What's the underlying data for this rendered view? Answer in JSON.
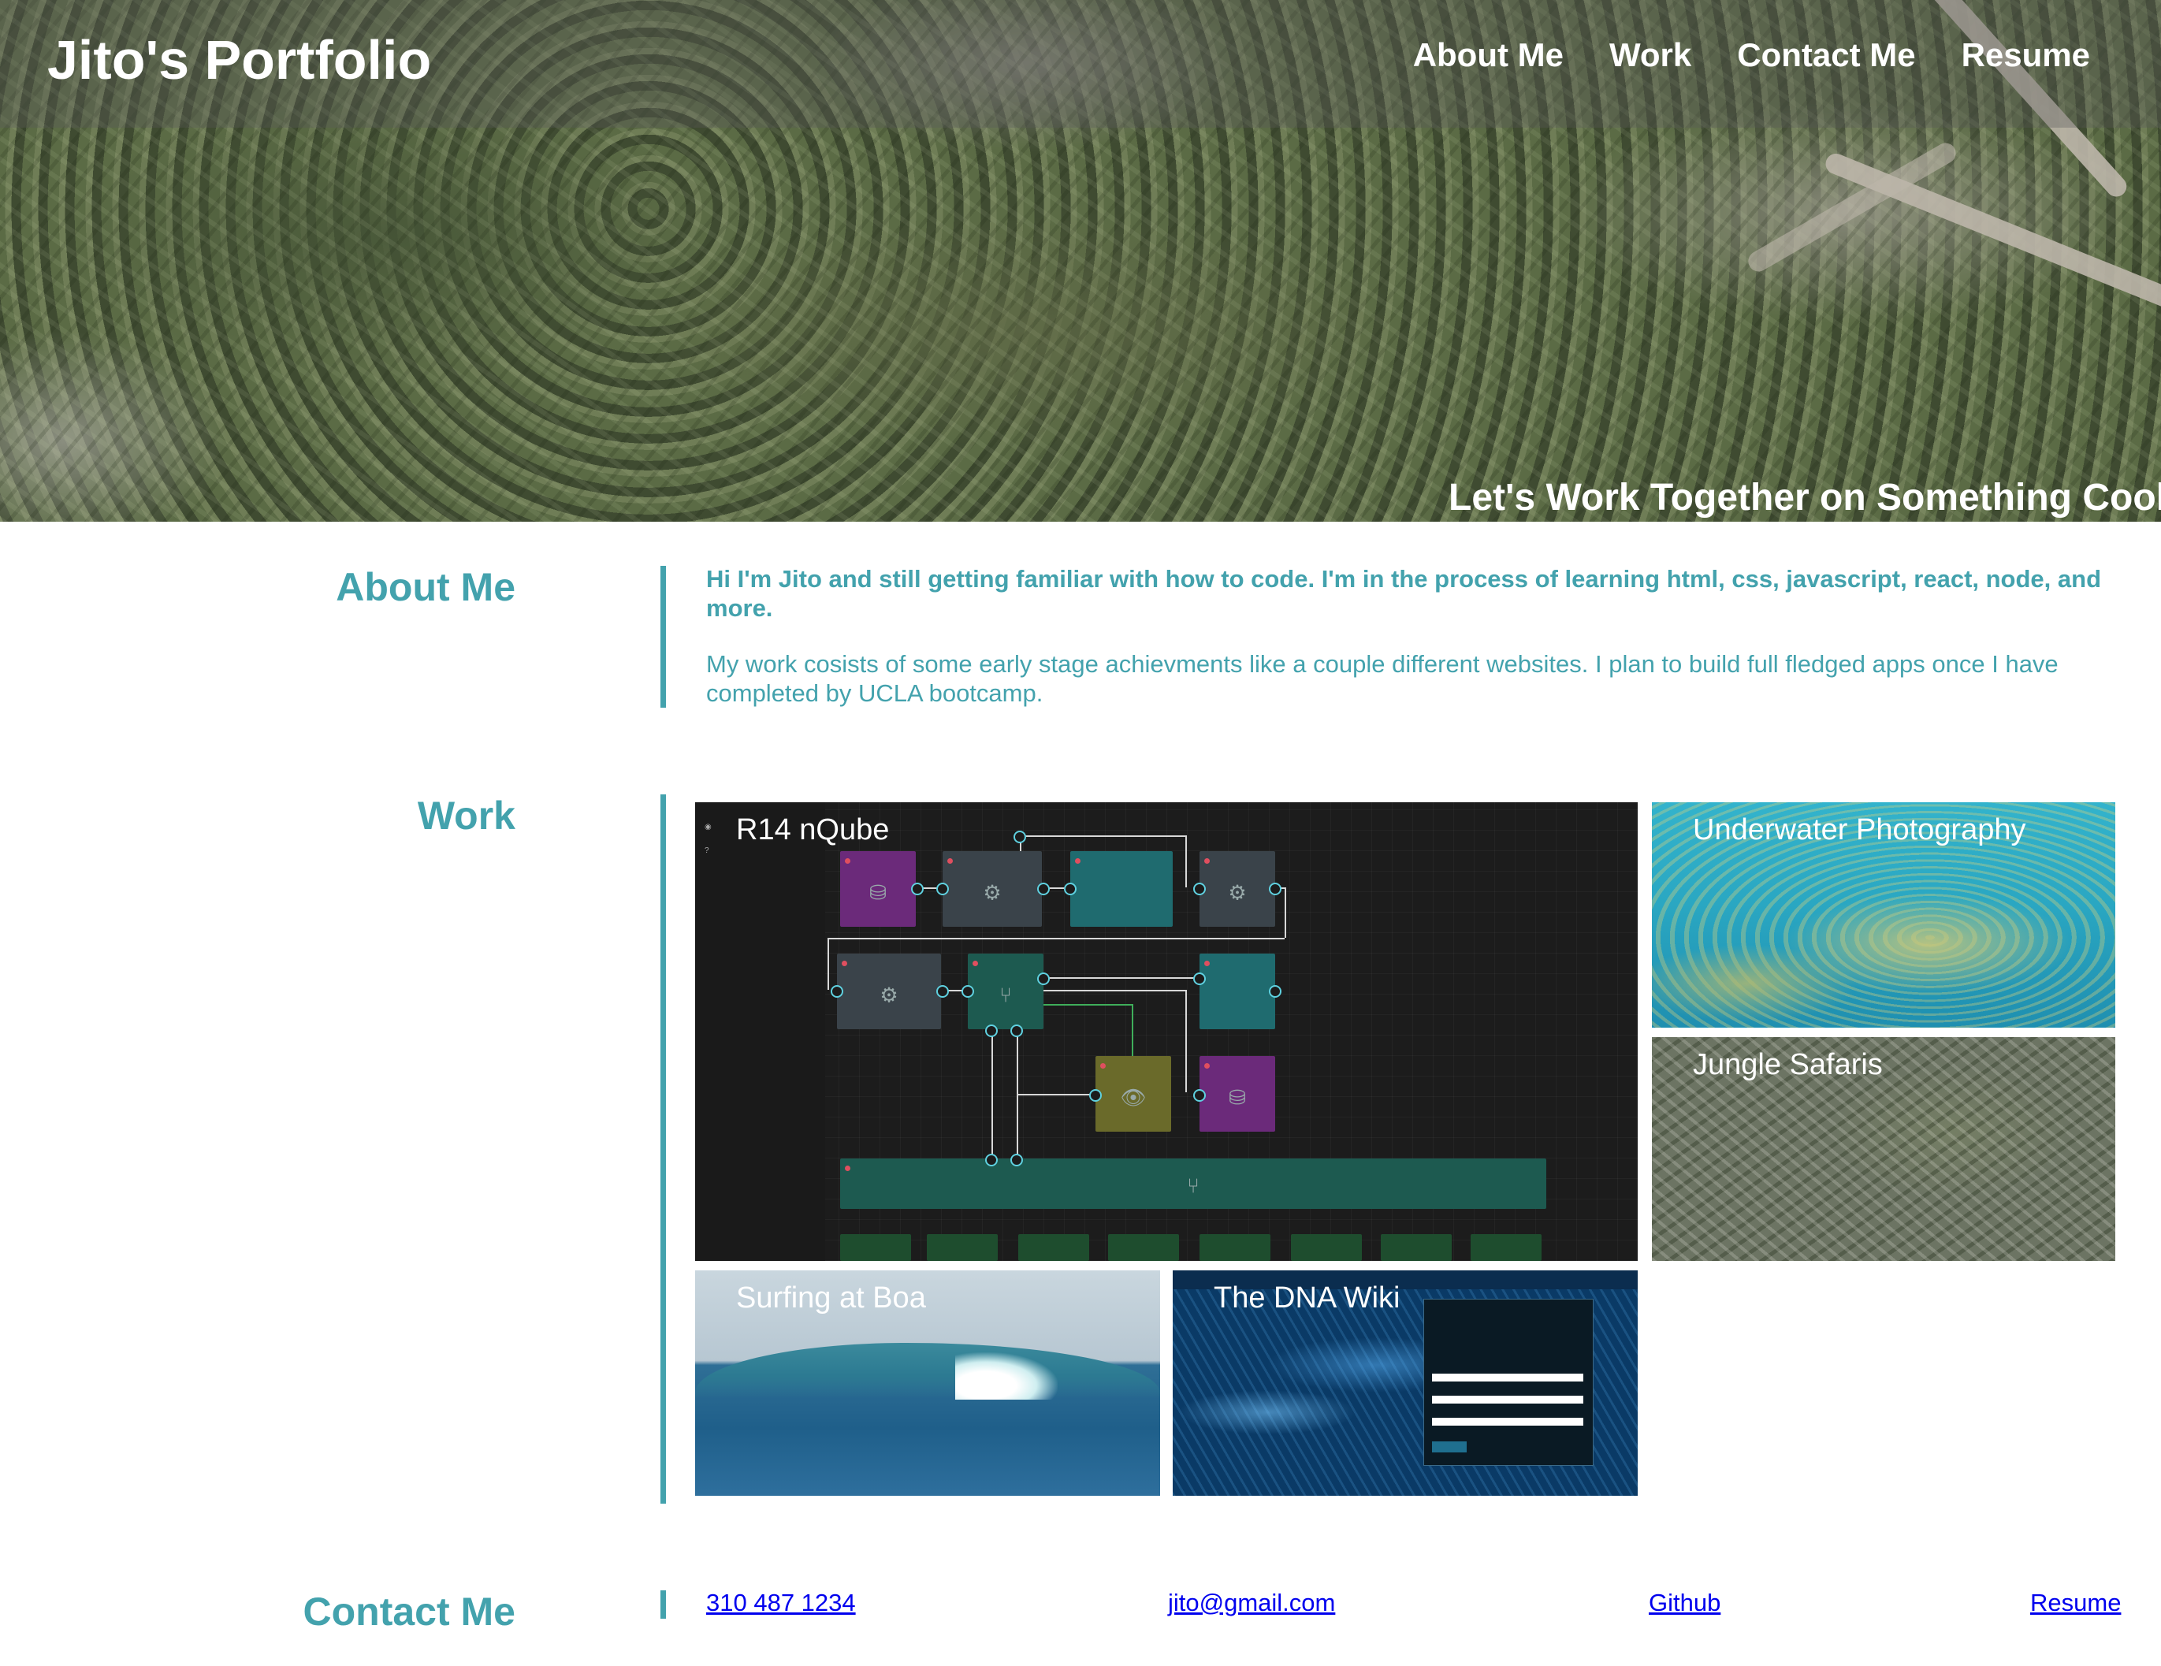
{
  "header": {
    "title": "Jito's Portfolio",
    "nav": [
      "About Me",
      "Work",
      "Contact Me",
      "Resume"
    ]
  },
  "hero": {
    "tagline": "Let's Work Together on Something Cool"
  },
  "about": {
    "title": "About Me",
    "intro": "Hi I'm Jito and still getting familiar with how to code. I'm in the process of learning html, css, javascript, react, node, and more.",
    "body": "My work cosists of some early stage achievments like a couple different websites. I plan to build full fledged apps once I have completed by UCLA bootcamp."
  },
  "work": {
    "title": "Work",
    "projects": [
      "R14 nQube",
      "Underwater Photography",
      "Jungle Safaris",
      "Surfing at Boa",
      "The DNA Wiki"
    ]
  },
  "contact": {
    "title": "Contact Me",
    "phone": "310 487 1234",
    "email": "jito@gmail.com",
    "github": "Github",
    "resume": "Resume"
  },
  "colors": {
    "accent": "#43a2ad",
    "link": "#0000ee"
  }
}
